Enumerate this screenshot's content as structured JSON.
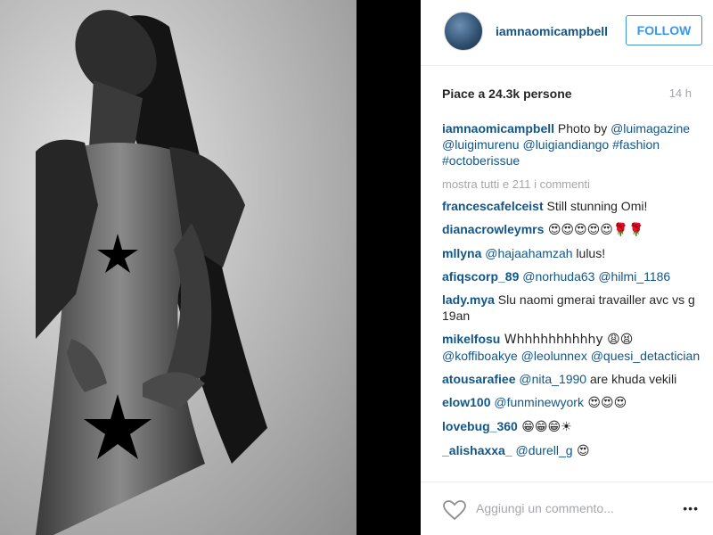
{
  "post": {
    "username": "iamnaomicampbell",
    "follow_label": "FOLLOW",
    "likes": "Piace a 24.3k persone",
    "time": "14 h",
    "caption_user": "iamnaomicampbell",
    "caption_text": " Photo by ",
    "caption_tags": [
      "@luimagazine",
      "@luigimurenu",
      "@luigiandiango",
      "#fashion",
      "#octoberissue"
    ],
    "view_all": "mostra tutti e 211 i commenti"
  },
  "comments": [
    {
      "user": "francescafelceist",
      "text": " Still stunning Omi!"
    },
    {
      "user": "dianacrowleymrs",
      "text": " 😍😍😍😍😍🌹🌹"
    },
    {
      "user": "mllyna",
      "text": " ",
      "mention": "@hajaahamzah",
      "rest": " lulus!"
    },
    {
      "user": "afiqscorp_89",
      "text": " ",
      "mention": "@norhuda63",
      "rest": " ",
      "mention2": "@hilmi_1186"
    },
    {
      "user": "lady.mya",
      "text": " Slu naomi gmerai travailler avc vs g 19an"
    },
    {
      "user": "mikelfosu",
      "text": " Whhhhhhhhhhy 😩😫",
      "mention": "@koffiboakye",
      "rest": " ",
      "mention2": "@leolunnex",
      "rest2": " ",
      "mention3": "@quesi_detactician"
    },
    {
      "user": "atousarafiee",
      "text": " ",
      "mention": "@nita_1990",
      "rest": " are khuda vekili"
    },
    {
      "user": "elow100",
      "text": " ",
      "mention": "@funminewyork",
      "rest": " 😍😍😍"
    },
    {
      "user": "lovebug_360",
      "text": " 😁😁😁☀"
    },
    {
      "user": "_alishaxxa_",
      "text": " ",
      "mention": "@durell_g",
      "rest": " 😍"
    }
  ],
  "footer": {
    "placeholder": "Aggiungi un commento...",
    "more": "•••"
  }
}
